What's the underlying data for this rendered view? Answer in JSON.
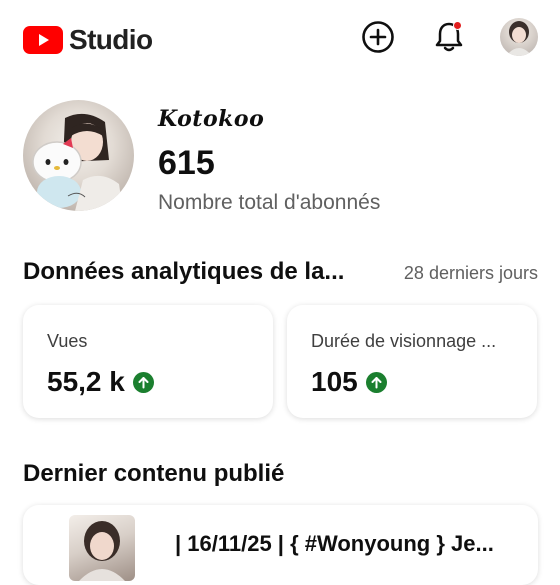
{
  "header": {
    "brand": "Studio",
    "icons": [
      "youtube-play-icon",
      "create-icon",
      "bell-icon",
      "account-avatar"
    ]
  },
  "channel": {
    "name": "Kotokoo",
    "subscribers": "615",
    "subscribers_label": "Nombre total d'abonnés"
  },
  "analytics": {
    "title": "Données analytiques de la...",
    "period": "28 derniers jours",
    "cards": [
      {
        "label": "Vues",
        "value": "55,2 k",
        "trend": "up"
      },
      {
        "label": "Durée de visionnage ...",
        "value": "105",
        "trend": "up"
      }
    ]
  },
  "latest": {
    "title": "Dernier contenu publié",
    "video_title": "| 16/11/25 | { #Wonyoung } Je..."
  },
  "colors": {
    "brand_red": "#ff0000",
    "trend_green": "#1b7f2f",
    "notification_dot": "#e11d1d",
    "secondary_text": "#606060"
  }
}
